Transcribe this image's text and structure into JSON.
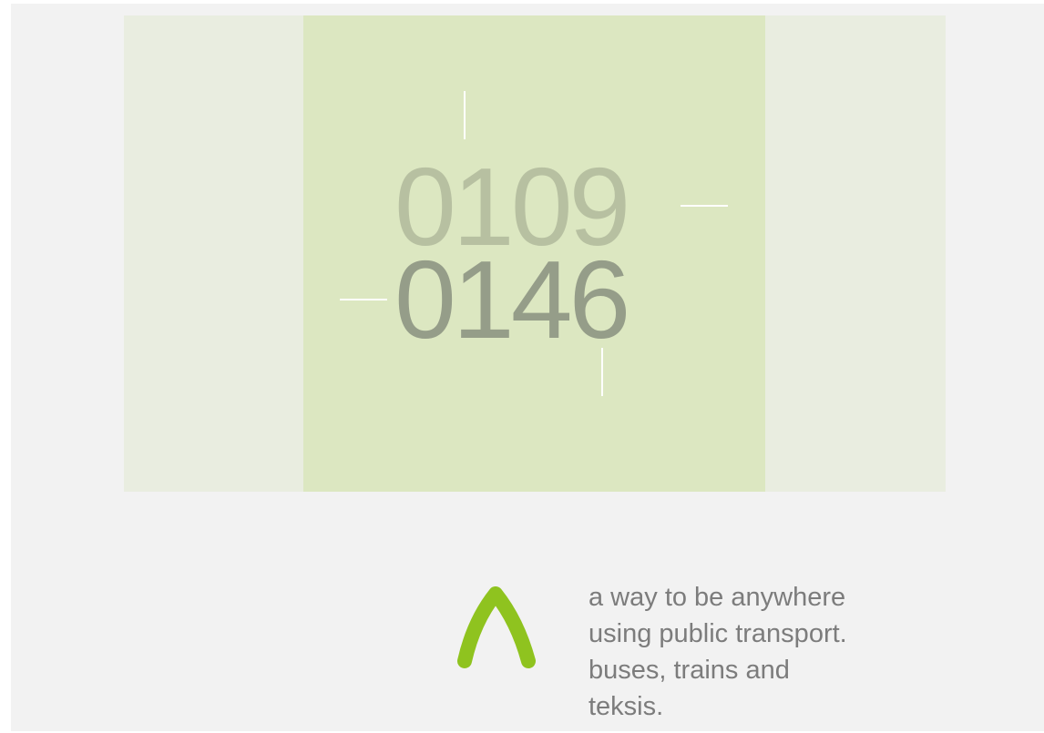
{
  "banner": {
    "depart_time": "0109",
    "arrive_time": "0146"
  },
  "brand": {
    "logo_icon": "caret-up-arch-icon",
    "accent_color": "#8fc31f",
    "tagline_lines": [
      "a way to be anywhere",
      "using public transport.",
      "buses, trains and",
      "teksis."
    ]
  }
}
